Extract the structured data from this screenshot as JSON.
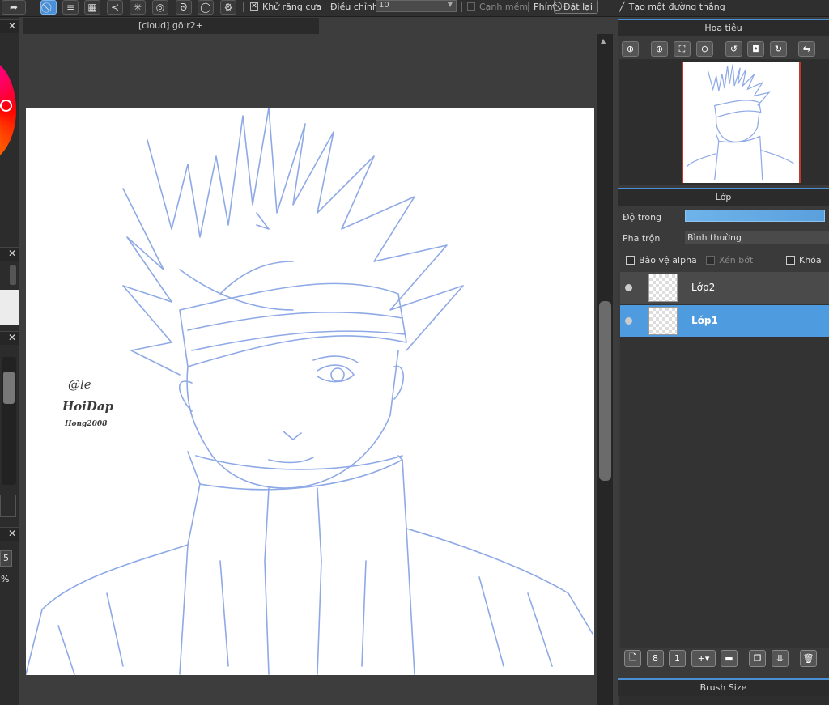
{
  "toolbar": {
    "antialias_label": "Khử răng cưa",
    "antialias_checked": true,
    "adjust_label": "Điều chỉnh",
    "adjust_value": "10",
    "soft_edge_label": "Cạnh mềm",
    "soft_edge_checked": false,
    "key_label": "Phím",
    "reset_label": "Đặt lại",
    "straight_line_label": "Tạo một đường thẳng",
    "icons": [
      "redo-icon",
      "no-snap-icon",
      "parallel-lines-icon",
      "grid-icon",
      "vanishing-point-icon",
      "radial-icon",
      "concentric-icon",
      "curve-icon",
      "circle-icon",
      "settings-icon"
    ]
  },
  "document": {
    "tab_title": "[cloud] gõ:r2+"
  },
  "canvas": {
    "signature_lines": [
      "@le",
      "HoiDap",
      "Hong2008"
    ]
  },
  "left_strip": {
    "value_a": "5",
    "value_b": "%"
  },
  "navigator": {
    "title": "Hoa tiêu",
    "buttons": [
      "zoom-actual-icon",
      "zoom-in-icon",
      "fit-icon",
      "zoom-out-icon",
      "rotate-left-icon",
      "fit-screen-icon",
      "rotate-right-icon",
      "flip-icon"
    ]
  },
  "layers": {
    "title": "Lớp",
    "opacity_label": "Độ trong",
    "opacity_value": 1.0,
    "blend_label": "Pha trộn",
    "blend_value": "Bình thường",
    "protect_alpha_label": "Bảo vệ alpha",
    "clipping_label": "Xén bớt",
    "lock_label": "Khóa",
    "items": [
      {
        "name": "Lớp2",
        "selected": false
      },
      {
        "name": "Lớp1",
        "selected": true
      }
    ],
    "bottom_buttons": [
      "new-layer-icon",
      "new-layer-8bit-icon",
      "new-layer-1bit-icon",
      "add-layer-menu-icon",
      "folder-icon",
      "duplicate-icon",
      "merge-icon",
      "delete-icon"
    ]
  },
  "brush_size": {
    "title": "Brush Size"
  },
  "colors": {
    "accent": "#4a8fd3",
    "selected_layer": "#4f9be0",
    "sketch_line": "#8ea9e6"
  }
}
